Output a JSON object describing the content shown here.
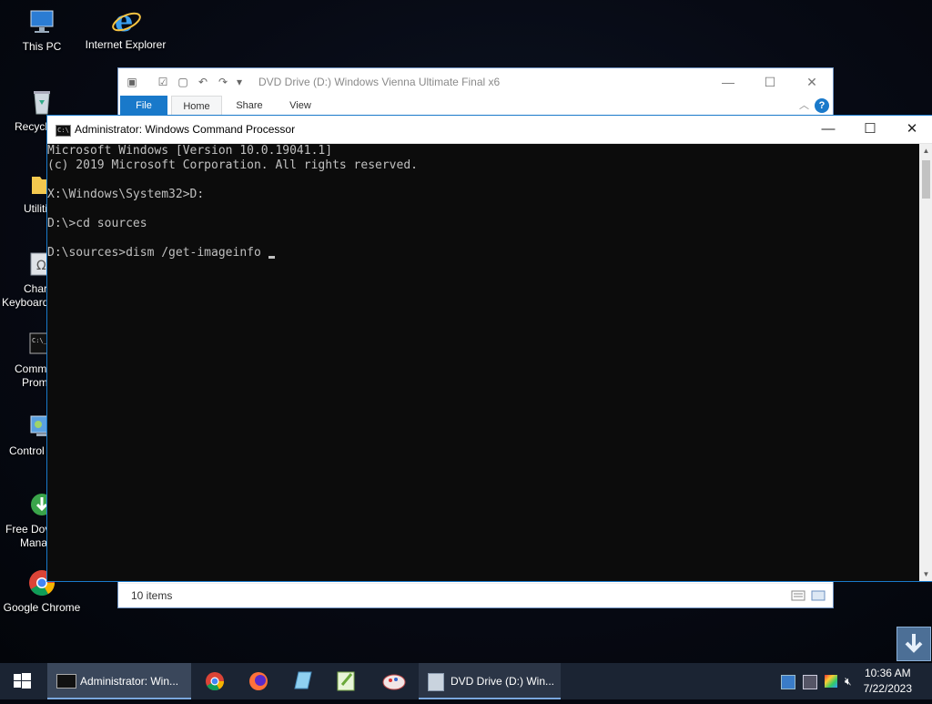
{
  "desktop": {
    "icons": [
      {
        "label": "This PC",
        "icon": "computer-icon"
      },
      {
        "label": "Internet Explorer",
        "icon": "internet-explorer-icon"
      },
      {
        "label": "Recycl",
        "icon": "recycle-bin-icon"
      },
      {
        "label": "Utiliti",
        "icon": "folder-icon"
      },
      {
        "label": "Char",
        "label2": "Keyboard",
        "icon": "character-map-icon"
      },
      {
        "label": "Comm",
        "label2": "Prom",
        "icon": "command-prompt-icon"
      },
      {
        "label": "Control",
        "icon": "control-panel-icon"
      },
      {
        "label": "Free Dov",
        "label2": "Mana",
        "icon": "download-manager-icon"
      },
      {
        "label": "Google Chrome",
        "icon": "chrome-icon"
      }
    ]
  },
  "explorer": {
    "title": "DVD Drive (D:) Windows Vienna Ultimate Final x6",
    "tabs": [
      "File",
      "Home",
      "Share",
      "View"
    ],
    "status_count": "10 items",
    "help": "?"
  },
  "cmd": {
    "title": "Administrator: Windows Command Processor",
    "lines": [
      "Microsoft Windows [Version 10.0.19041.1]",
      "(c) 2019 Microsoft Corporation. All rights reserved.",
      "",
      "X:\\Windows\\System32>D:",
      "",
      "D:\\>cd sources",
      "",
      "D:\\sources>dism /get-imageinfo"
    ]
  },
  "taskbar": {
    "start_icon": "windows-start-icon",
    "apps": [
      {
        "label": "Administrator: Win...",
        "icon": "command-prompt-icon"
      },
      {
        "label": "DVD Drive (D:) Win...",
        "icon": "dvd-drive-icon"
      }
    ],
    "pinned": [
      "chrome-icon",
      "firefox-icon",
      "notepad-icon",
      "notepad-plus-icon",
      "paint-icon"
    ],
    "clock_time": "10:36 AM",
    "clock_date": "7/22/2023"
  },
  "colors": {
    "accent": "#1979ca",
    "console_bg": "#0c0c0c",
    "console_fg": "#c0c0c0",
    "taskbar": "#1b2433"
  }
}
